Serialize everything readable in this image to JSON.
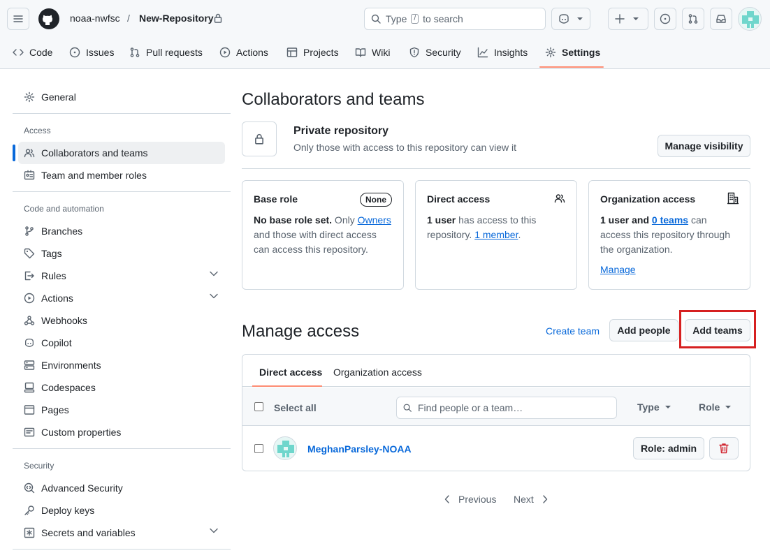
{
  "header": {
    "owner": "noaa-nwfsc",
    "separator": "/",
    "repo": "New-Repository",
    "search_prefix": "Type",
    "search_key": "/",
    "search_suffix": "to search"
  },
  "repo_tabs": [
    {
      "label": "Code",
      "icon": "code-icon"
    },
    {
      "label": "Issues",
      "icon": "issue-icon"
    },
    {
      "label": "Pull requests",
      "icon": "pull-request-icon"
    },
    {
      "label": "Actions",
      "icon": "play-icon"
    },
    {
      "label": "Projects",
      "icon": "table-icon"
    },
    {
      "label": "Wiki",
      "icon": "book-icon"
    },
    {
      "label": "Security",
      "icon": "shield-icon"
    },
    {
      "label": "Insights",
      "icon": "graph-icon"
    },
    {
      "label": "Settings",
      "icon": "gear-icon",
      "selected": true
    }
  ],
  "sidebar": {
    "general": "General",
    "access_heading": "Access",
    "access_items": [
      "Collaborators and teams",
      "Team and member roles"
    ],
    "code_heading": "Code and automation",
    "code_items": [
      "Branches",
      "Tags",
      "Rules",
      "Actions",
      "Webhooks",
      "Copilot",
      "Environments",
      "Codespaces",
      "Pages",
      "Custom properties"
    ],
    "security_heading": "Security",
    "security_items": [
      "Advanced Security",
      "Deploy keys",
      "Secrets and variables"
    ]
  },
  "main": {
    "title": "Collaborators and teams",
    "visibility": {
      "title": "Private repository",
      "subtitle": "Only those with access to this repository can view it",
      "button": "Manage visibility"
    },
    "cards": {
      "base_role": {
        "title": "Base role",
        "badge": "None",
        "bold": "No base role set.",
        "text1": " Only ",
        "link": "Owners",
        "text2": " and those with direct access can access this repository."
      },
      "direct": {
        "title": "Direct access",
        "bold": "1 user",
        "text1": " has access to this repository. ",
        "link": "1 member",
        "text2": "."
      },
      "org": {
        "title": "Organization access",
        "bold": "1 user and ",
        "link": "0 teams",
        "text1": " can access this repository through the organization.",
        "manage": "Manage"
      }
    },
    "manage_access": {
      "title": "Manage access",
      "create_team": "Create team",
      "add_people": "Add people",
      "add_teams": "Add teams",
      "highlight_color": "#d62020"
    },
    "access_tabs": [
      "Direct access",
      "Organization access"
    ],
    "select_all": "Select all",
    "filter_placeholder": "Find people or a team…",
    "type_label": "Type",
    "role_label": "Role",
    "member": {
      "name": "MeghanParsley-NOAA",
      "role": "Role: admin"
    },
    "pagination": {
      "previous": "Previous",
      "next": "Next"
    }
  },
  "colors": {
    "accent": "#0969da",
    "tab_underline": "#fd8c73",
    "danger": "#d1242f"
  }
}
